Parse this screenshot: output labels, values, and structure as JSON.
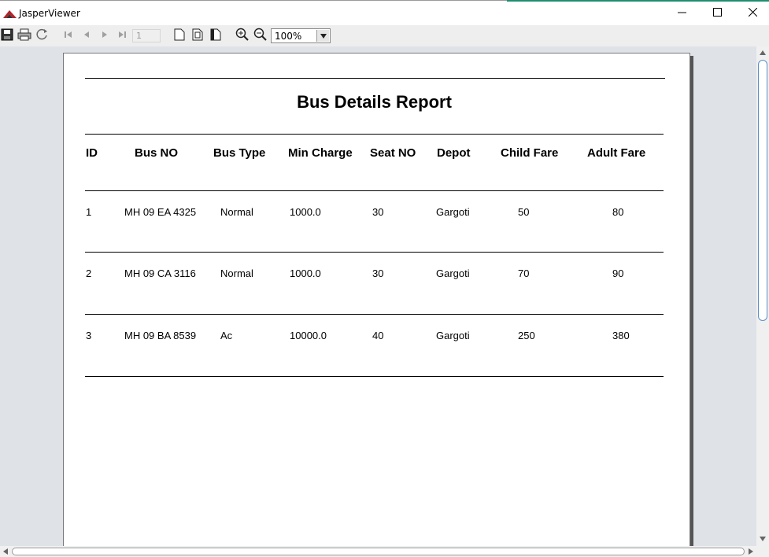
{
  "window": {
    "title": "JasperViewer",
    "controls": [
      "minimize-icon",
      "maximize-icon",
      "close-icon"
    ]
  },
  "toolbar": {
    "buttons": [
      "save-icon",
      "print-icon",
      "reload-icon",
      "first-page-icon",
      "previous-page-icon",
      "next-page-icon",
      "last-page-icon",
      "actual-size-icon",
      "fit-page-icon",
      "fit-width-icon",
      "zoom-in-icon",
      "zoom-out-icon"
    ],
    "page_number": "1",
    "zoom": "100%"
  },
  "report": {
    "title": "Bus Details Report",
    "columns": [
      "ID",
      "Bus NO",
      "Bus Type",
      "Min Charge",
      "Seat NO",
      "Depot",
      "Child Fare",
      "Adult Fare"
    ],
    "rows": [
      [
        "1",
        "MH 09 EA 4325",
        "Normal",
        "1000.0",
        "30",
        "Gargoti",
        "50",
        "80"
      ],
      [
        "2",
        "MH 09 CA 3116",
        "Normal",
        "1000.0",
        "30",
        "Gargoti",
        "70",
        "90"
      ],
      [
        "3",
        "MH 09 BA 8539",
        "Ac",
        "10000.0",
        "40",
        "Gargoti",
        "250",
        "380"
      ]
    ]
  },
  "colors": {
    "viewer_background": "#dfe3e8",
    "toolbar_background": "#eeeeee",
    "titlebar_accent": "#1e8f6e",
    "logo_red": "#b1232a"
  }
}
